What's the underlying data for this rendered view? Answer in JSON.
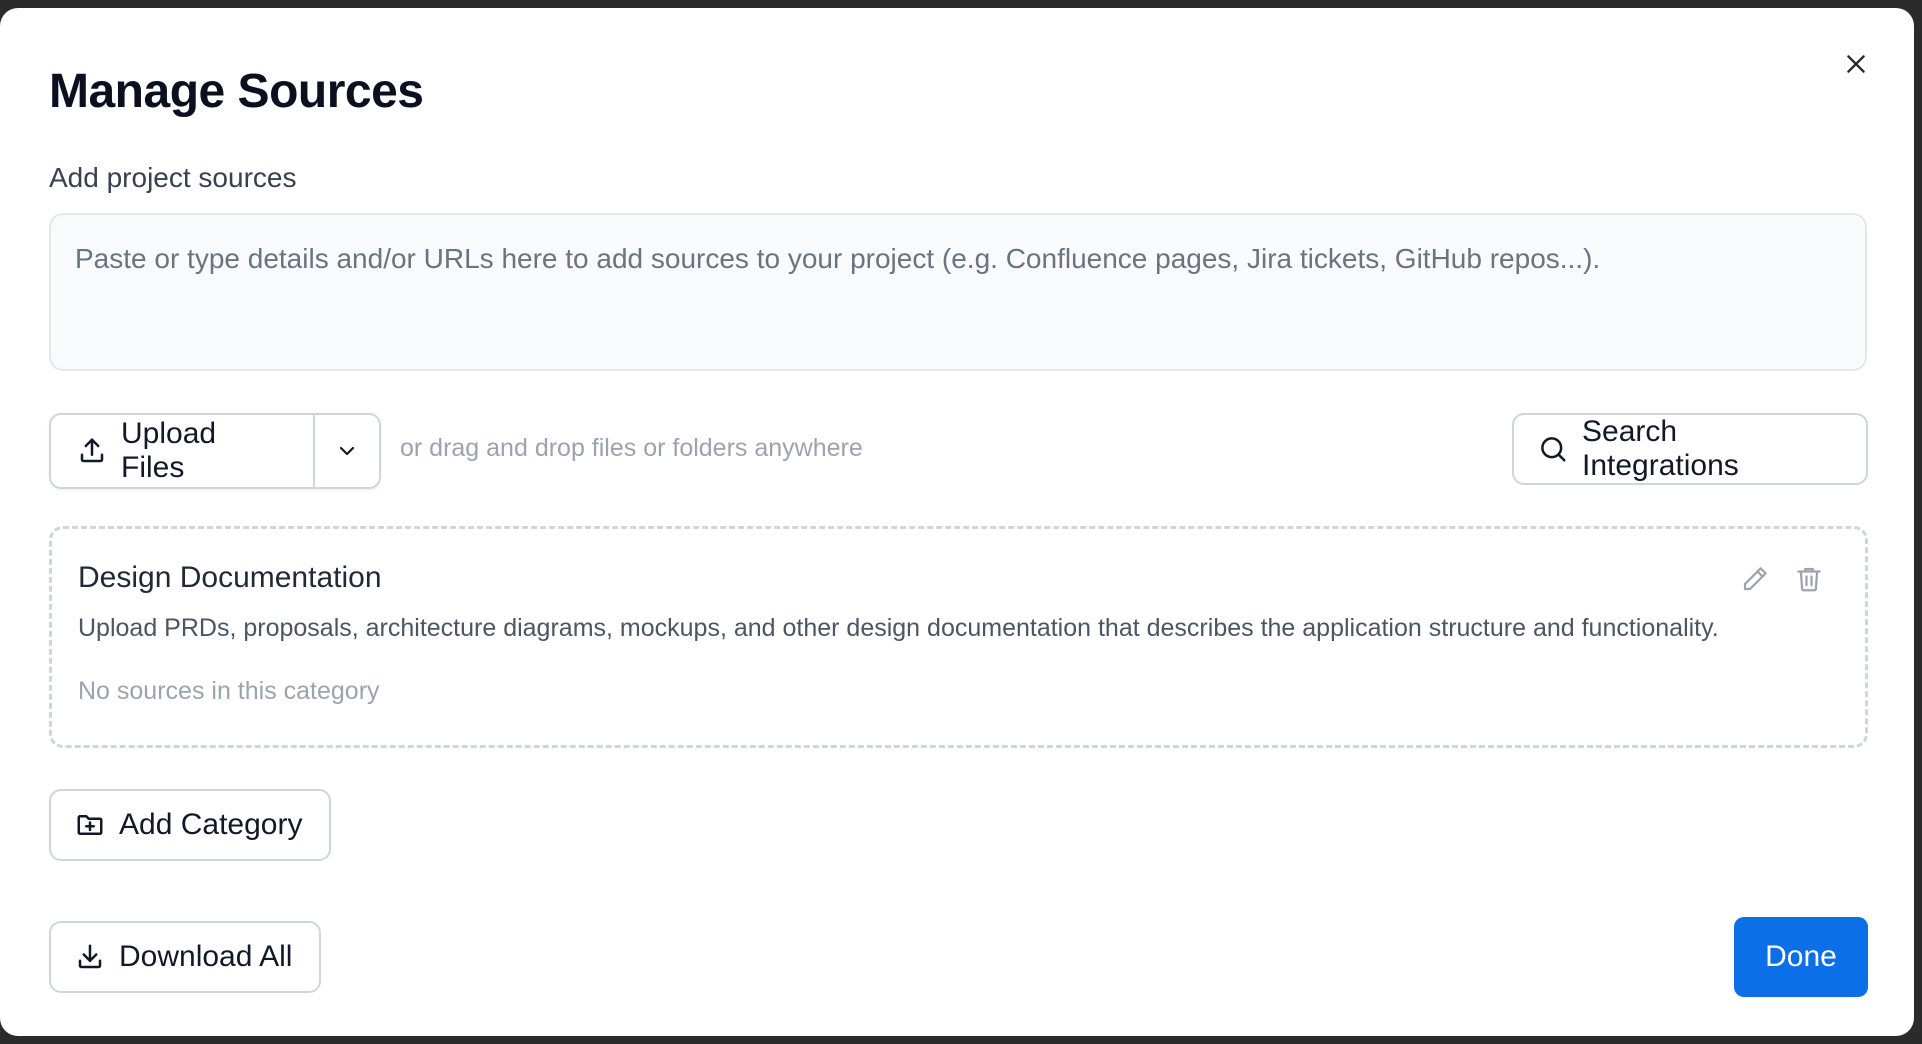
{
  "dialog": {
    "title": "Manage Sources",
    "close_icon": "close-icon"
  },
  "sources_input": {
    "label": "Add project sources",
    "placeholder": "Paste or type details and/or URLs here to add sources to your project (e.g. Confluence pages, Jira tickets, GitHub repos...).",
    "value": ""
  },
  "upload": {
    "label": "Upload Files",
    "icon": "upload-icon",
    "dropdown_icon": "chevron-down-icon",
    "drag_hint": "or drag and drop files or folders anywhere"
  },
  "search_integrations": {
    "label": "Search Integrations",
    "icon": "search-icon"
  },
  "categories": [
    {
      "title": "Design Documentation",
      "description": "Upload PRDs, proposals, architecture diagrams, mockups, and other design documentation that describes the application structure and functionality.",
      "empty_text": "No sources in this category",
      "edit_icon": "pencil-icon",
      "delete_icon": "trash-icon"
    }
  ],
  "add_category": {
    "label": "Add Category",
    "icon": "folder-plus-icon"
  },
  "download_all": {
    "label": "Download All",
    "icon": "download-icon"
  },
  "done": {
    "label": "Done"
  },
  "colors": {
    "primary": "#0b6fe8",
    "border": "#d1d5db",
    "muted_text": "#9ca3af",
    "backdrop": "#2b2b2b"
  }
}
